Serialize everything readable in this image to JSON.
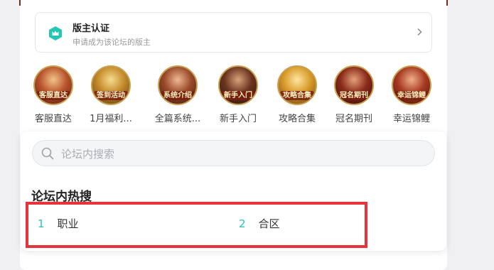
{
  "moderator": {
    "title": "版主认证",
    "subtitle": "申请成为该论坛的版主",
    "icon": "crown-shield-icon",
    "accent": "#26c6b4"
  },
  "shortcuts": [
    {
      "badge": "客服直达",
      "caption": "客服直达",
      "bg": "#8a2b1e"
    },
    {
      "badge": "签到活动",
      "caption": "1月福利...",
      "bg": "#9a6a1c"
    },
    {
      "badge": "系统介绍",
      "caption": "全篇系统...",
      "bg": "#7a3a22"
    },
    {
      "badge": "新手入门",
      "caption": "新手入门",
      "bg": "#5a2a1a"
    },
    {
      "badge": "攻略合集",
      "caption": "攻略合集",
      "bg": "#a87a20"
    },
    {
      "badge": "冠名期刊",
      "caption": "冠名期刊",
      "bg": "#6a2418"
    },
    {
      "badge": "幸运锦鲤",
      "caption": "幸运锦鲤",
      "bg": "#8c2a20"
    }
  ],
  "search": {
    "placeholder": "论坛内搜索"
  },
  "hot": {
    "title": "论坛内热搜",
    "items": [
      {
        "rank": "1",
        "label": "职业"
      },
      {
        "rank": "2",
        "label": "合区"
      }
    ]
  },
  "colors": {
    "rank": "#29c3b8",
    "highlight": "#e8333a"
  }
}
